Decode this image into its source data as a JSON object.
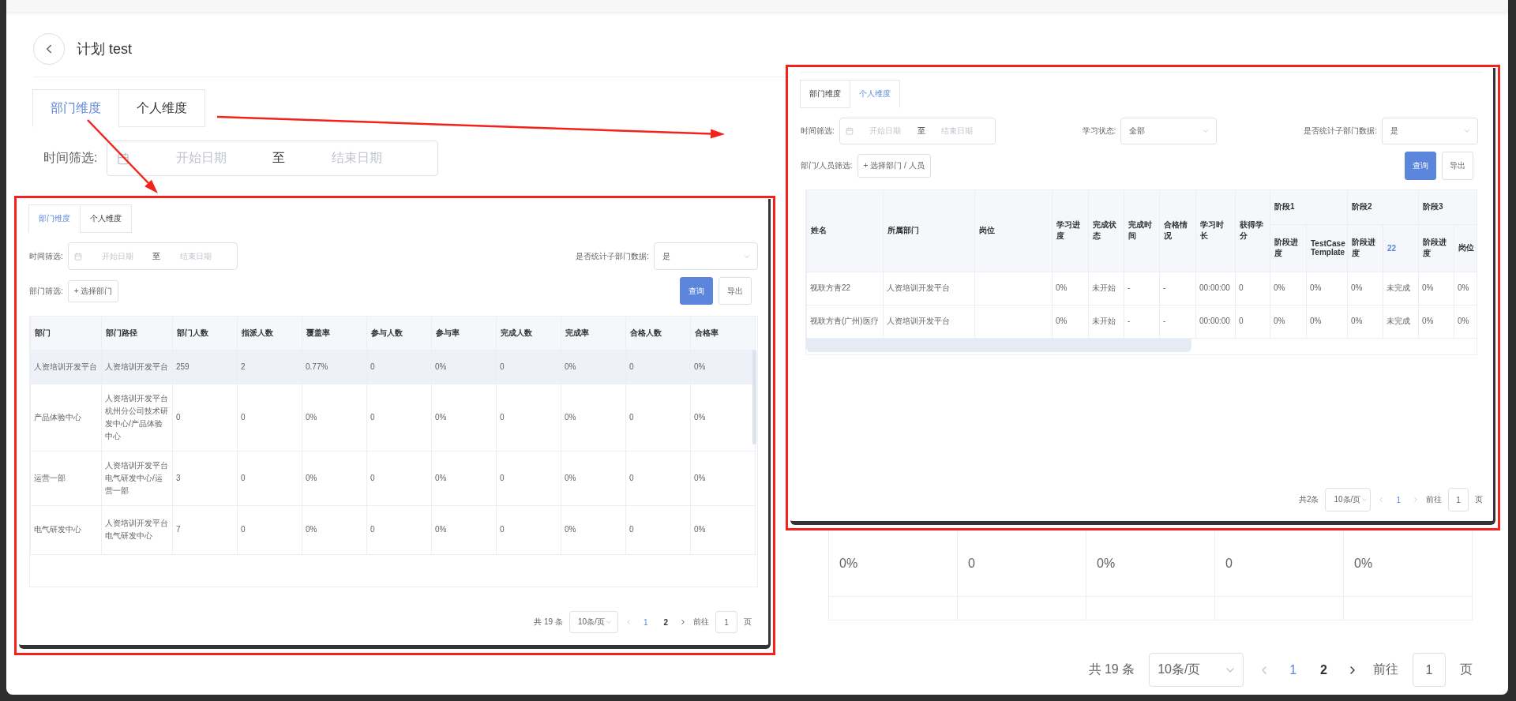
{
  "page": {
    "title": "计划 test",
    "tabs": [
      {
        "label": "部门维度",
        "selected": true
      },
      {
        "label": "个人维度",
        "selected": false
      }
    ],
    "time_filter": {
      "label": "时间筛选:",
      "start_placeholder": "开始日期",
      "separator": "至",
      "end_placeholder": "结束日期"
    },
    "table_partial_row": [
      "0%",
      "0",
      "0%",
      "0",
      "0%"
    ],
    "pagination": {
      "total": "共 19 条",
      "page_size": "10条/页",
      "pages": [
        {
          "label": "1",
          "selected": true
        },
        {
          "label": "2",
          "selected": false
        }
      ],
      "goto_label": "前往",
      "goto_value": "1",
      "goto_suffix": "页"
    }
  },
  "dept_view": {
    "tabs": [
      {
        "label": "部门维度",
        "selected": true
      },
      {
        "label": "个人维度",
        "selected": false
      }
    ],
    "time_filter": {
      "label": "时间筛选:",
      "start_placeholder": "开始日期",
      "separator": "至",
      "end_placeholder": "结束日期"
    },
    "stat_sub": {
      "label": "是否统计子部门数据:",
      "value": "是"
    },
    "dept_filter": {
      "label": "部门筛选:",
      "button": "+ 选择部门"
    },
    "buttons": [
      {
        "label": "查询",
        "kind": "primary"
      },
      {
        "label": "导出",
        "kind": "default"
      }
    ],
    "table": {
      "columns": [
        "部门",
        "部门路径",
        "部门人数",
        "指派人数",
        "覆盖率",
        "参与人数",
        "参与率",
        "完成人数",
        "完成率",
        "合格人数",
        "合格率"
      ],
      "rows": [
        {
          "highlighted": true,
          "cells": [
            "人资培训开发平台",
            "人资培训开发平台",
            "259",
            "2",
            "0.77%",
            "0",
            "0%",
            "0",
            "0%",
            "0",
            "0%"
          ]
        },
        {
          "highlighted": false,
          "cells": [
            "产品体验中心",
            "人资培训开发平台杭州分公司技术研发中心/产品体验中心",
            "0",
            "0",
            "0%",
            "0",
            "0%",
            "0",
            "0%",
            "0",
            "0%"
          ]
        },
        {
          "highlighted": false,
          "cells": [
            "运营一部",
            "人资培训开发平台电气研发中心/运营一部",
            "3",
            "0",
            "0%",
            "0",
            "0%",
            "0",
            "0%",
            "0",
            "0%"
          ]
        },
        {
          "highlighted": false,
          "cells": [
            "电气研发中心",
            "人资培训开发平台电气研发中心",
            "7",
            "0",
            "0%",
            "0",
            "0%",
            "0",
            "0%",
            "0",
            "0%"
          ]
        }
      ]
    },
    "pagination": {
      "total": "共 19 条",
      "page_size": "10条/页",
      "pages": [
        {
          "label": "1",
          "selected": true
        },
        {
          "label": "2",
          "selected": false
        }
      ],
      "goto_label": "前往",
      "goto_value": "1",
      "goto_suffix": "页"
    }
  },
  "person_view": {
    "tabs": [
      {
        "label": "部门维度",
        "selected": false
      },
      {
        "label": "个人维度",
        "selected": true
      }
    ],
    "time_filter": {
      "label": "时间筛选:",
      "start_placeholder": "开始日期",
      "separator": "至",
      "end_placeholder": "结束日期"
    },
    "study_status": {
      "label": "学习状态:",
      "value": "全部"
    },
    "stat_sub": {
      "label": "是否统计子部门数据:",
      "value": "是"
    },
    "dept_filter": {
      "label": "部门/人员筛选:",
      "button": "+ 选择部门 / 人员"
    },
    "buttons": [
      {
        "label": "查询",
        "kind": "primary"
      },
      {
        "label": "导出",
        "kind": "default"
      }
    ],
    "table": {
      "columns": [
        {
          "label": "姓名"
        },
        {
          "label": "所属部门"
        },
        {
          "label": "岗位"
        },
        {
          "label": "学习进度"
        },
        {
          "label": "完成状态"
        },
        {
          "label": "完成时间"
        },
        {
          "label": "合格情况"
        },
        {
          "label": "学习时长"
        },
        {
          "label": "获得学分"
        }
      ],
      "stages": [
        {
          "label": "阶段1",
          "children": [
            {
              "label": "阶段进度",
              "link": false
            },
            {
              "label": "TestCase Template",
              "link": false
            }
          ]
        },
        {
          "label": "阶段2",
          "children": [
            {
              "label": "阶段进度",
              "link": false
            },
            {
              "label": "22",
              "link": true
            }
          ]
        },
        {
          "label": "阶段3",
          "children": [
            {
              "label": "阶段进度",
              "link": false
            },
            {
              "label": "岗位",
              "link": false
            }
          ]
        }
      ],
      "rows": [
        [
          "视联方青22",
          "人资培训开发平台",
          null,
          "0%",
          "未开始",
          "-",
          "-",
          "00:00:00",
          "0",
          "0%",
          "0%",
          "0%",
          "未完成",
          "0%",
          "0%"
        ],
        [
          "视联方青(广州)医疗",
          "人资培训开发平台",
          null,
          "0%",
          "未开始",
          "-",
          "-",
          "00:00:00",
          "0",
          "0%",
          "0%",
          "0%",
          "未完成",
          "0%",
          "0%"
        ]
      ]
    },
    "pagination": {
      "total": "共2条",
      "page_size": "10条/页",
      "pages": [
        {
          "label": "1",
          "selected": true
        }
      ],
      "goto_label": "前往",
      "goto_value": "1",
      "goto_suffix": "页"
    }
  }
}
